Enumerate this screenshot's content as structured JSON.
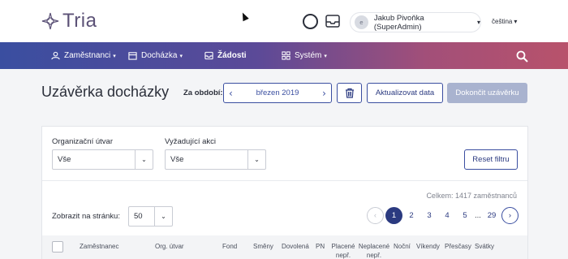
{
  "app": {
    "logo_text": "Tria"
  },
  "header": {
    "user_initial": "e",
    "user_name": "Jakub Pivoňka (SuperAdmin)",
    "language": "čeština"
  },
  "nav": {
    "items": [
      {
        "label": "Zaměstnanci",
        "icon": "person-icon",
        "dropdown": true
      },
      {
        "label": "Docházka",
        "icon": "calendar-icon",
        "dropdown": true
      },
      {
        "label": "Žádosti",
        "icon": "inbox-icon",
        "dropdown": false
      },
      {
        "label": "Systém",
        "icon": "grid-icon",
        "dropdown": true
      }
    ]
  },
  "page": {
    "title": "Uzávěrka docházky",
    "period_label": "Za období:",
    "period_value": "březen 2019",
    "update_button": "Aktualizovat data",
    "finish_button": "Dokončit uzávěrku"
  },
  "filters": {
    "unit_label": "Organizační útvar",
    "unit_value": "Vše",
    "action_label": "Vyžadující akci",
    "action_value": "Vše",
    "reset_button": "Reset filtru"
  },
  "list": {
    "total": "Celkem: 1417 zaměstnanců",
    "per_page_label": "Zobrazit na stránku:",
    "per_page_value": "50",
    "pages": [
      "1",
      "2",
      "3",
      "4",
      "5",
      "...",
      "29"
    ],
    "current_page": "1"
  },
  "table": {
    "columns": [
      "Zaměstnanec",
      "Org. útvar",
      "Fond",
      "Směny",
      "Dovolená",
      "PN",
      "Placené nepř.",
      "Neplacené nepř.",
      "Noční",
      "Víkendy",
      "Přesčasy",
      "Svátky"
    ]
  },
  "colors": {
    "primary": "#2b3a80",
    "nav_gradient_start": "#3a4ea0",
    "nav_gradient_end": "#b8526b",
    "disabled_button": "#a9b3cf"
  }
}
